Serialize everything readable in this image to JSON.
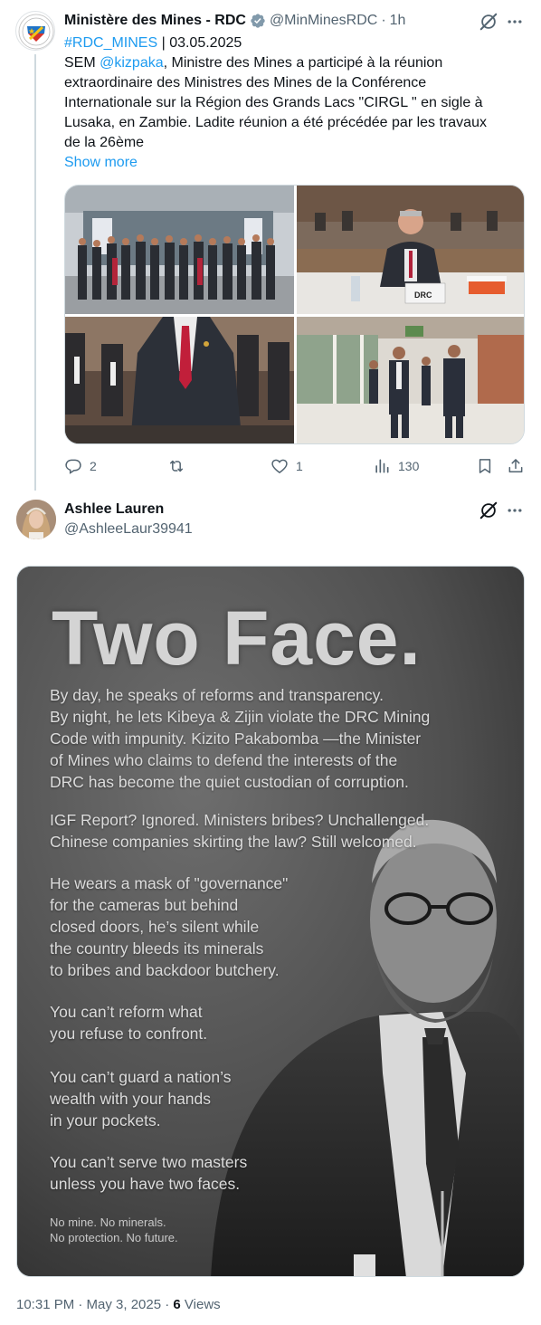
{
  "tweet1": {
    "display_name": "Ministère des Mines - RDC",
    "handle": "@MinMinesRDC",
    "separator": "·",
    "time": "1h",
    "text_lines": [
      {
        "hashtag": "#RDC_MINES",
        "rest": " | 03.05.2025"
      },
      {
        "prefix": "SEM ",
        "mention": "@kizpaka",
        "rest": ", Ministre des Mines a participé à la réunion"
      },
      "extraordinaire des Ministres des Mines de la Conférence",
      "Internationale sur la Région des Grands Lacs \"CIRGL \" en sigle à",
      "Lusaka, en Zambie. Ladite réunion a été précédée par les travaux",
      "de la 26ème"
    ],
    "show_more": "Show more",
    "media_label": "DRC",
    "stats": {
      "replies": "2",
      "reposts": "",
      "likes": "1",
      "views": "130"
    }
  },
  "tweet2": {
    "display_name": "Ashlee Lauren",
    "handle": "@AshleeLaur39941",
    "poster": {
      "title": "Two Face.",
      "paragraphs": [
        [
          "By day, he speaks of reforms and transparency.",
          "By night, he lets Kibeya & Zijin violate the DRC Mining",
          "Code with impunity. Kizito Pakabomba —the Minister",
          "of Mines who claims to defend the interests of the",
          "DRC has become the quiet custodian of corruption."
        ],
        [
          "IGF Report? Ignored. Ministers bribes? Unchallenged.",
          "Chinese companies skirting the law? Still welcomed."
        ],
        [
          "He wears a mask of \"governance\"",
          "for the cameras but behind",
          "closed doors, he’s silent while",
          "the country bleeds its minerals",
          "to bribes and backdoor butchery."
        ],
        [
          "You can’t reform what",
          "you refuse to confront."
        ],
        [
          "You can’t guard a nation’s",
          "wealth with your hands",
          "in your pockets."
        ],
        [
          "You can’t serve two masters",
          "unless you have two faces."
        ]
      ],
      "closing": [
        "No mine. No minerals.",
        "No protection. No future."
      ]
    },
    "timestamp": "10:31 PM · May 3, 2025 · ",
    "views_count": "6",
    "views_label": " Views"
  },
  "colors": {
    "link": "#1d9bf0",
    "muted": "#536471",
    "verified": "#829aab",
    "text": "#0f1419"
  }
}
